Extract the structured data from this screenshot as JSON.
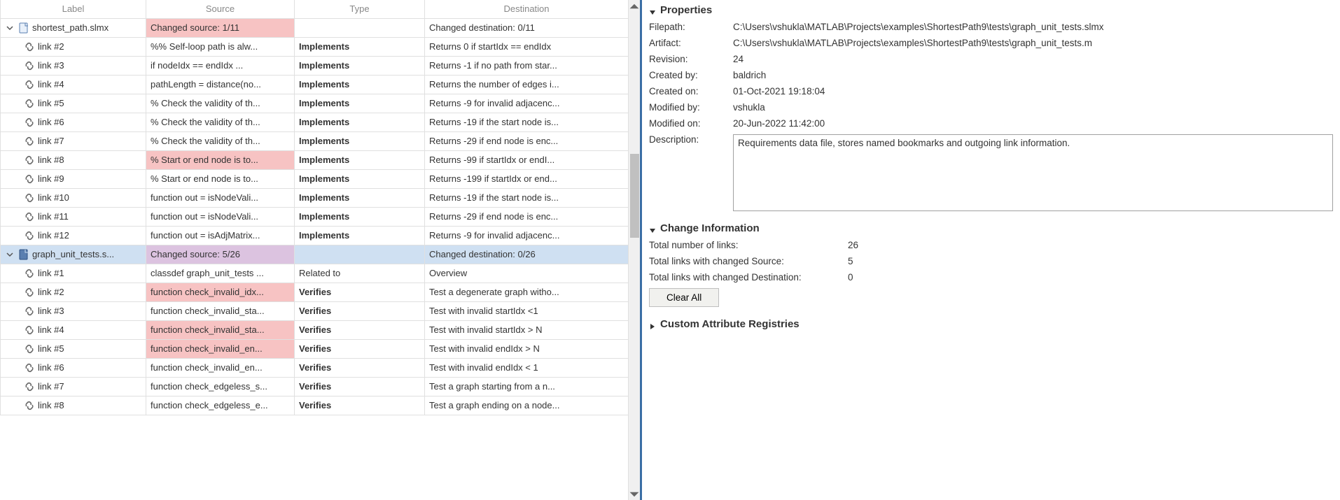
{
  "columns": [
    "Label",
    "Source",
    "Type",
    "Destination"
  ],
  "groups": [
    {
      "label": "shortest_path.slmx",
      "iconType": "doc",
      "sourceSummary": "Changed source: 1/11",
      "destSummary": "Changed destination: 0/11",
      "selected": false,
      "rows": [
        {
          "label": "link #2",
          "source": "%% Self-loop path is alw...",
          "sourceHL": false,
          "type": "Implements",
          "dest": "Returns 0 if startIdx == endIdx"
        },
        {
          "label": "link #3",
          "source": "if nodeIdx == endIdx     ...",
          "sourceHL": false,
          "type": "Implements",
          "dest": "Returns -1 if no path from star..."
        },
        {
          "label": "link #4",
          "source": "pathLength = distance(no...",
          "sourceHL": false,
          "type": "Implements",
          "dest": "Returns the number of edges i..."
        },
        {
          "label": "link #5",
          "source": "% Check the validity of th...",
          "sourceHL": false,
          "type": "Implements",
          "dest": "Returns -9 for invalid adjacenc..."
        },
        {
          "label": "link #6",
          "source": "% Check the validity of th...",
          "sourceHL": false,
          "type": "Implements",
          "dest": "Returns -19 if the start node is..."
        },
        {
          "label": "link #7",
          "source": "% Check the validity of th...",
          "sourceHL": false,
          "type": "Implements",
          "dest": "Returns -29 if end node is enc..."
        },
        {
          "label": "link #8",
          "source": "% Start or end node is to...",
          "sourceHL": true,
          "type": "Implements",
          "dest": "Returns -99 if startIdx or endI..."
        },
        {
          "label": "link #9",
          "source": "% Start or end node is to...",
          "sourceHL": false,
          "type": "Implements",
          "dest": "Returns -199 if startIdx or end..."
        },
        {
          "label": "link #10",
          "source": "function out = isNodeVali...",
          "sourceHL": false,
          "type": "Implements",
          "dest": "Returns -19 if the start node is..."
        },
        {
          "label": "link #11",
          "source": "function out = isNodeVali...",
          "sourceHL": false,
          "type": "Implements",
          "dest": "Returns -29 if end node is enc..."
        },
        {
          "label": "link #12",
          "source": "function out = isAdjMatrix...",
          "sourceHL": false,
          "type": "Implements",
          "dest": "Returns -9 for invalid adjacenc..."
        }
      ]
    },
    {
      "label": "graph_unit_tests.s...",
      "iconType": "doc-sel",
      "sourceSummary": "Changed source: 5/26",
      "destSummary": "Changed destination: 0/26",
      "selected": true,
      "rows": [
        {
          "label": "link #1",
          "source": "classdef graph_unit_tests ...",
          "sourceHL": false,
          "type": "Related to",
          "dest": "Overview"
        },
        {
          "label": "link #2",
          "source": "function check_invalid_idx...",
          "sourceHL": true,
          "type": "Verifies",
          "dest": "Test a degenerate graph witho..."
        },
        {
          "label": "link #3",
          "source": "function check_invalid_sta...",
          "sourceHL": false,
          "type": "Verifies",
          "dest": "Test with invalid startIdx <1"
        },
        {
          "label": "link #4",
          "source": "function check_invalid_sta...",
          "sourceHL": true,
          "type": "Verifies",
          "dest": "Test with invalid startIdx > N"
        },
        {
          "label": "link #5",
          "source": "function check_invalid_en...",
          "sourceHL": true,
          "type": "Verifies",
          "dest": "Test with invalid endIdx > N"
        },
        {
          "label": "link #6",
          "source": "function check_invalid_en...",
          "sourceHL": false,
          "type": "Verifies",
          "dest": "Test with invalid endIdx < 1"
        },
        {
          "label": "link #7",
          "source": "function check_edgeless_s...",
          "sourceHL": false,
          "type": "Verifies",
          "dest": "Test a graph starting from a n..."
        },
        {
          "label": "link #8",
          "source": "function check_edgeless_e...",
          "sourceHL": false,
          "type": "Verifies",
          "dest": "Test a graph ending on a node..."
        }
      ]
    }
  ],
  "properties": {
    "sectionTitle": "Properties",
    "fields": {
      "Filepath:": "C:\\Users\\vshukla\\MATLAB\\Projects\\examples\\ShortestPath9\\tests\\graph_unit_tests.slmx",
      "Artifact:": "C:\\Users\\vshukla\\MATLAB\\Projects\\examples\\ShortestPath9\\tests\\graph_unit_tests.m",
      "Revision:": "24",
      "Created by:": "baldrich",
      "Created on:": "01-Oct-2021 19:18:04",
      "Modified by:": "vshukla",
      "Modified on:": "20-Jun-2022 11:42:00"
    },
    "descriptionLabel": "Description:",
    "descriptionText": "Requirements data file, stores named bookmarks and outgoing link information."
  },
  "changeInfo": {
    "sectionTitle": "Change Information",
    "rows": [
      {
        "label": "Total number of links:",
        "value": "26"
      },
      {
        "label": "Total links with changed Source:",
        "value": "5"
      },
      {
        "label": "Total links with changed Destination:",
        "value": "0"
      }
    ],
    "clearAll": "Clear All"
  },
  "customAttr": {
    "sectionTitle": "Custom Attribute Registries"
  }
}
